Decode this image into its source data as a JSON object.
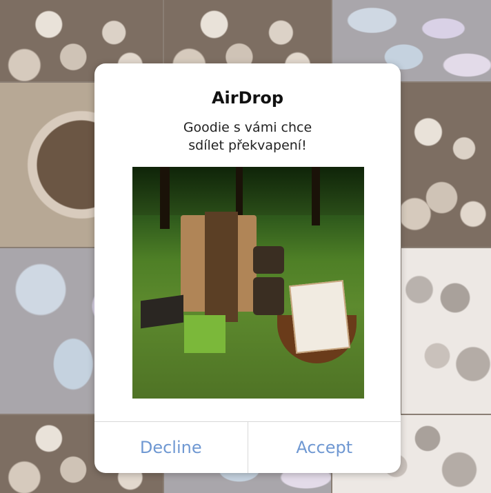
{
  "dialog": {
    "title": "AirDrop",
    "message": "Goodie s vámi chce\nsdílet překvapení!",
    "accent_color": "#6f98d2"
  },
  "buttons": {
    "decline_label": "Decline",
    "accept_label": "Accept"
  }
}
